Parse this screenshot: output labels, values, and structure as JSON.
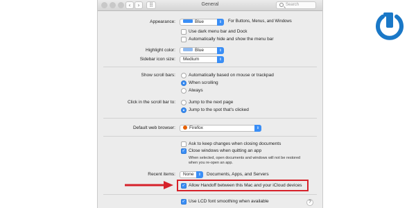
{
  "window": {
    "title": "General",
    "search_placeholder": "Search"
  },
  "appearance": {
    "label": "Appearance:",
    "value": "Blue",
    "suffix": "For Buttons, Menus, and Windows",
    "dark_menu": "Use dark menu bar and Dock",
    "auto_hide": "Automatically hide and show the menu bar"
  },
  "highlight": {
    "label": "Highlight color:",
    "value": "Blue"
  },
  "sidebar": {
    "label": "Sidebar icon size:",
    "value": "Medium"
  },
  "scroll_bars": {
    "label": "Show scroll bars:",
    "options": [
      "Automatically based on mouse or trackpad",
      "When scrolling",
      "Always"
    ],
    "selected": "When scrolling"
  },
  "click_scroll": {
    "label": "Click in the scroll bar to:",
    "options": [
      "Jump to the next page",
      "Jump to the spot that's clicked"
    ],
    "selected": "Jump to the spot that's clicked"
  },
  "browser": {
    "label": "Default web browser:",
    "value": "Firefox"
  },
  "documents": {
    "ask_keep": "Ask to keep changes when closing documents",
    "close_windows": "Close windows when quitting an app",
    "note_line1": "When selected, open documents and windows will not be restored",
    "note_line2": "when you re-open an app."
  },
  "recent": {
    "label": "Recent items:",
    "value": "None",
    "suffix": "Documents, Apps, and Servers"
  },
  "handoff": {
    "label": "Allow Handoff between this Mac and your iCloud devices"
  },
  "lcd": {
    "label": "Use LCD font smoothing when available"
  },
  "help": {
    "label": "?"
  },
  "colors": {
    "accent": "#3a8ef6",
    "callout_red": "#d6212a",
    "logo_blue": "#1a78c7"
  }
}
